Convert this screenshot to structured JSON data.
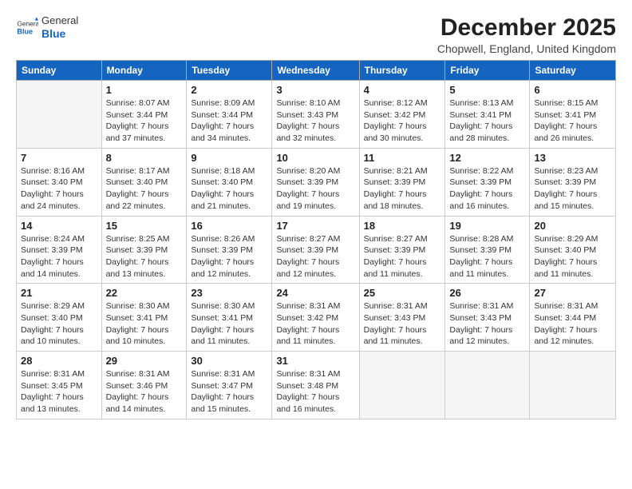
{
  "logo": {
    "general": "General",
    "blue": "Blue"
  },
  "header": {
    "title": "December 2025",
    "subtitle": "Chopwell, England, United Kingdom"
  },
  "weekdays": [
    "Sunday",
    "Monday",
    "Tuesday",
    "Wednesday",
    "Thursday",
    "Friday",
    "Saturday"
  ],
  "weeks": [
    [
      {
        "day": "",
        "sunrise": "",
        "sunset": "",
        "daylight": ""
      },
      {
        "day": "1",
        "sunrise": "Sunrise: 8:07 AM",
        "sunset": "Sunset: 3:44 PM",
        "daylight": "Daylight: 7 hours and 37 minutes."
      },
      {
        "day": "2",
        "sunrise": "Sunrise: 8:09 AM",
        "sunset": "Sunset: 3:44 PM",
        "daylight": "Daylight: 7 hours and 34 minutes."
      },
      {
        "day": "3",
        "sunrise": "Sunrise: 8:10 AM",
        "sunset": "Sunset: 3:43 PM",
        "daylight": "Daylight: 7 hours and 32 minutes."
      },
      {
        "day": "4",
        "sunrise": "Sunrise: 8:12 AM",
        "sunset": "Sunset: 3:42 PM",
        "daylight": "Daylight: 7 hours and 30 minutes."
      },
      {
        "day": "5",
        "sunrise": "Sunrise: 8:13 AM",
        "sunset": "Sunset: 3:41 PM",
        "daylight": "Daylight: 7 hours and 28 minutes."
      },
      {
        "day": "6",
        "sunrise": "Sunrise: 8:15 AM",
        "sunset": "Sunset: 3:41 PM",
        "daylight": "Daylight: 7 hours and 26 minutes."
      }
    ],
    [
      {
        "day": "7",
        "sunrise": "Sunrise: 8:16 AM",
        "sunset": "Sunset: 3:40 PM",
        "daylight": "Daylight: 7 hours and 24 minutes."
      },
      {
        "day": "8",
        "sunrise": "Sunrise: 8:17 AM",
        "sunset": "Sunset: 3:40 PM",
        "daylight": "Daylight: 7 hours and 22 minutes."
      },
      {
        "day": "9",
        "sunrise": "Sunrise: 8:18 AM",
        "sunset": "Sunset: 3:40 PM",
        "daylight": "Daylight: 7 hours and 21 minutes."
      },
      {
        "day": "10",
        "sunrise": "Sunrise: 8:20 AM",
        "sunset": "Sunset: 3:39 PM",
        "daylight": "Daylight: 7 hours and 19 minutes."
      },
      {
        "day": "11",
        "sunrise": "Sunrise: 8:21 AM",
        "sunset": "Sunset: 3:39 PM",
        "daylight": "Daylight: 7 hours and 18 minutes."
      },
      {
        "day": "12",
        "sunrise": "Sunrise: 8:22 AM",
        "sunset": "Sunset: 3:39 PM",
        "daylight": "Daylight: 7 hours and 16 minutes."
      },
      {
        "day": "13",
        "sunrise": "Sunrise: 8:23 AM",
        "sunset": "Sunset: 3:39 PM",
        "daylight": "Daylight: 7 hours and 15 minutes."
      }
    ],
    [
      {
        "day": "14",
        "sunrise": "Sunrise: 8:24 AM",
        "sunset": "Sunset: 3:39 PM",
        "daylight": "Daylight: 7 hours and 14 minutes."
      },
      {
        "day": "15",
        "sunrise": "Sunrise: 8:25 AM",
        "sunset": "Sunset: 3:39 PM",
        "daylight": "Daylight: 7 hours and 13 minutes."
      },
      {
        "day": "16",
        "sunrise": "Sunrise: 8:26 AM",
        "sunset": "Sunset: 3:39 PM",
        "daylight": "Daylight: 7 hours and 12 minutes."
      },
      {
        "day": "17",
        "sunrise": "Sunrise: 8:27 AM",
        "sunset": "Sunset: 3:39 PM",
        "daylight": "Daylight: 7 hours and 12 minutes."
      },
      {
        "day": "18",
        "sunrise": "Sunrise: 8:27 AM",
        "sunset": "Sunset: 3:39 PM",
        "daylight": "Daylight: 7 hours and 11 minutes."
      },
      {
        "day": "19",
        "sunrise": "Sunrise: 8:28 AM",
        "sunset": "Sunset: 3:39 PM",
        "daylight": "Daylight: 7 hours and 11 minutes."
      },
      {
        "day": "20",
        "sunrise": "Sunrise: 8:29 AM",
        "sunset": "Sunset: 3:40 PM",
        "daylight": "Daylight: 7 hours and 11 minutes."
      }
    ],
    [
      {
        "day": "21",
        "sunrise": "Sunrise: 8:29 AM",
        "sunset": "Sunset: 3:40 PM",
        "daylight": "Daylight: 7 hours and 10 minutes."
      },
      {
        "day": "22",
        "sunrise": "Sunrise: 8:30 AM",
        "sunset": "Sunset: 3:41 PM",
        "daylight": "Daylight: 7 hours and 10 minutes."
      },
      {
        "day": "23",
        "sunrise": "Sunrise: 8:30 AM",
        "sunset": "Sunset: 3:41 PM",
        "daylight": "Daylight: 7 hours and 11 minutes."
      },
      {
        "day": "24",
        "sunrise": "Sunrise: 8:31 AM",
        "sunset": "Sunset: 3:42 PM",
        "daylight": "Daylight: 7 hours and 11 minutes."
      },
      {
        "day": "25",
        "sunrise": "Sunrise: 8:31 AM",
        "sunset": "Sunset: 3:43 PM",
        "daylight": "Daylight: 7 hours and 11 minutes."
      },
      {
        "day": "26",
        "sunrise": "Sunrise: 8:31 AM",
        "sunset": "Sunset: 3:43 PM",
        "daylight": "Daylight: 7 hours and 12 minutes."
      },
      {
        "day": "27",
        "sunrise": "Sunrise: 8:31 AM",
        "sunset": "Sunset: 3:44 PM",
        "daylight": "Daylight: 7 hours and 12 minutes."
      }
    ],
    [
      {
        "day": "28",
        "sunrise": "Sunrise: 8:31 AM",
        "sunset": "Sunset: 3:45 PM",
        "daylight": "Daylight: 7 hours and 13 minutes."
      },
      {
        "day": "29",
        "sunrise": "Sunrise: 8:31 AM",
        "sunset": "Sunset: 3:46 PM",
        "daylight": "Daylight: 7 hours and 14 minutes."
      },
      {
        "day": "30",
        "sunrise": "Sunrise: 8:31 AM",
        "sunset": "Sunset: 3:47 PM",
        "daylight": "Daylight: 7 hours and 15 minutes."
      },
      {
        "day": "31",
        "sunrise": "Sunrise: 8:31 AM",
        "sunset": "Sunset: 3:48 PM",
        "daylight": "Daylight: 7 hours and 16 minutes."
      },
      {
        "day": "",
        "sunrise": "",
        "sunset": "",
        "daylight": ""
      },
      {
        "day": "",
        "sunrise": "",
        "sunset": "",
        "daylight": ""
      },
      {
        "day": "",
        "sunrise": "",
        "sunset": "",
        "daylight": ""
      }
    ]
  ]
}
